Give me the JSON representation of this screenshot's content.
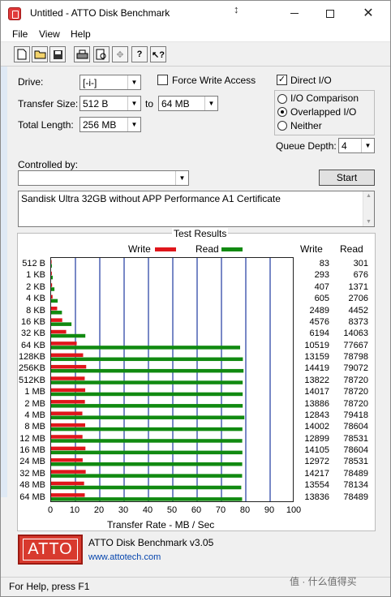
{
  "window": {
    "title": "Untitled - ATTO Disk Benchmark"
  },
  "menu": [
    "File",
    "View",
    "Help"
  ],
  "toolbar": {
    "icons": [
      "new-file-icon",
      "open-folder-icon",
      "save-icon",
      "print-icon",
      "print-preview-icon",
      "move-icon",
      "help-icon",
      "context-help-icon"
    ]
  },
  "form": {
    "drive_label": "Drive:",
    "drive_value": "[-i-]",
    "force_write_label": "Force Write Access",
    "force_write_checked": false,
    "transfer_size_label": "Transfer Size:",
    "transfer_from": "512 B",
    "to_label": "to",
    "transfer_to": "64 MB",
    "total_length_label": "Total Length:",
    "total_length": "256 MB",
    "direct_io_label": "Direct I/O",
    "direct_io_checked": true,
    "io_comparison_label": "I/O Comparison",
    "overlapped_io_label": "Overlapped I/O",
    "neither_label": "Neither",
    "selected_mode": "Overlapped I/O",
    "queue_depth_label": "Queue Depth:",
    "queue_depth": "4",
    "controlled_by_label": "Controlled by:",
    "controlled_by_value": "",
    "start_label": "Start",
    "description": "Sandisk Ultra 32GB without APP Performance A1 Certificate"
  },
  "results": {
    "title": "Test Results",
    "legend_write": "Write",
    "legend_read": "Read",
    "write_color": "#e0161b",
    "read_color": "#118a11",
    "col_write": "Write",
    "col_read": "Read"
  },
  "chart_data": {
    "type": "bar",
    "orientation": "horizontal",
    "categories": [
      "512 B",
      "1 KB",
      "2 KB",
      "4 KB",
      "8 KB",
      "16 KB",
      "32 KB",
      "64 KB",
      "128KB",
      "256KB",
      "512KB",
      "1 MB",
      "2 MB",
      "4 MB",
      "8 MB",
      "12 MB",
      "16 MB",
      "24 MB",
      "32 MB",
      "48 MB",
      "64 MB"
    ],
    "series": [
      {
        "name": "Write",
        "values": [
          83,
          293,
          407,
          605,
          2489,
          4576,
          6194,
          10519,
          13159,
          14419,
          13822,
          14017,
          13886,
          12843,
          14002,
          12899,
          14105,
          12972,
          14217,
          13554,
          13836
        ]
      },
      {
        "name": "Read",
        "values": [
          301,
          676,
          1371,
          2706,
          4452,
          8373,
          14063,
          77667,
          78798,
          79072,
          78720,
          78720,
          78720,
          79418,
          78604,
          78531,
          78604,
          78531,
          78489,
          78134,
          78489
        ]
      }
    ],
    "xlabel": "Transfer Rate - MB / Sec",
    "xlim": [
      0,
      100
    ],
    "xticks": [
      "0",
      "10",
      "20",
      "30",
      "40",
      "50",
      "60",
      "70",
      "80",
      "90",
      "100"
    ],
    "grid": "vertical"
  },
  "footer": {
    "product": "ATTO Disk Benchmark v3.05",
    "url": "www.attotech.com",
    "logo_text": "ATTO"
  },
  "status": {
    "text": "For Help, press F1"
  },
  "watermark": "值 · 什么值得买"
}
